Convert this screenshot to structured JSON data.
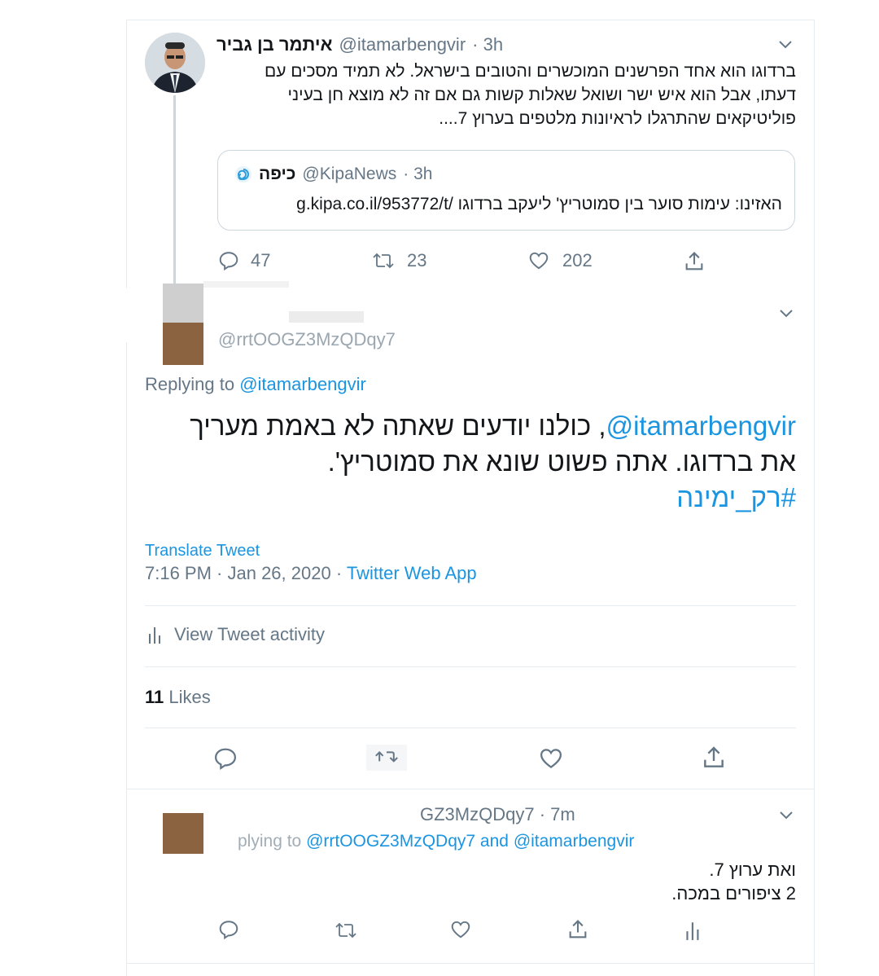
{
  "tweet1": {
    "display_name": "איתמר בן גביר",
    "handle": "@itamarbengvir",
    "dot_time": "· 3h",
    "text_lines": [
      "ברדוגו הוא אחד הפרשנים המוכשרים והטובים בישראל. לא תמיד מסכים עם",
      "דעתו, אבל הוא איש ישר ושואל שאלות קשות גם אם זה לא מוצא חן בעיני",
      "פוליטיקאים שהתרגלו לראיונות מלטפים בערוץ 7...."
    ],
    "quote": {
      "name": "כיפה",
      "handle": "@KipaNews",
      "dot_time": "· 3h",
      "text": "האזינו: עימות סוער בין סמוטריץ' ליעקב ברדוגו /g.kipa.co.il/953772/t"
    },
    "reply_count": "47",
    "retweet_count": "23",
    "like_count": "202"
  },
  "main_tweet": {
    "handle_partial": "@rrtOOGZ3MzQDqy7",
    "replying_label": "Replying to",
    "replying_handle": "@itamarbengvir",
    "text_line1_mention": "@itamarbengvir",
    "text_line1_rest": ", כולנו יודעים שאתה לא באמת מעריך",
    "text_line2": "את ברדוגו. אתה פשוט שונא את סמוטריץ'.",
    "hashtag": "#רק_ימינה",
    "translate": "Translate Tweet",
    "time": "7:16 PM · Jan 26, 2020 · ",
    "source": "Twitter Web App",
    "activity": "View Tweet activity",
    "likes_count": "11",
    "likes_label": "Likes"
  },
  "reply_tweet": {
    "handle_partial": "GZ3MzQDqy7",
    "dot_time": "· 7m",
    "replying_label": "plying to",
    "replying_handle1": "@rrtOOGZ3MzQDqy7",
    "and_label": "and",
    "replying_handle2": "@itamarbengvir",
    "text_line1": "ואת ערוץ 7.",
    "text_line2": "2 ציפורים במכה."
  },
  "colors": {
    "accent": "#1b95e0",
    "muted": "#657786",
    "divider": "#e6ecf0"
  }
}
